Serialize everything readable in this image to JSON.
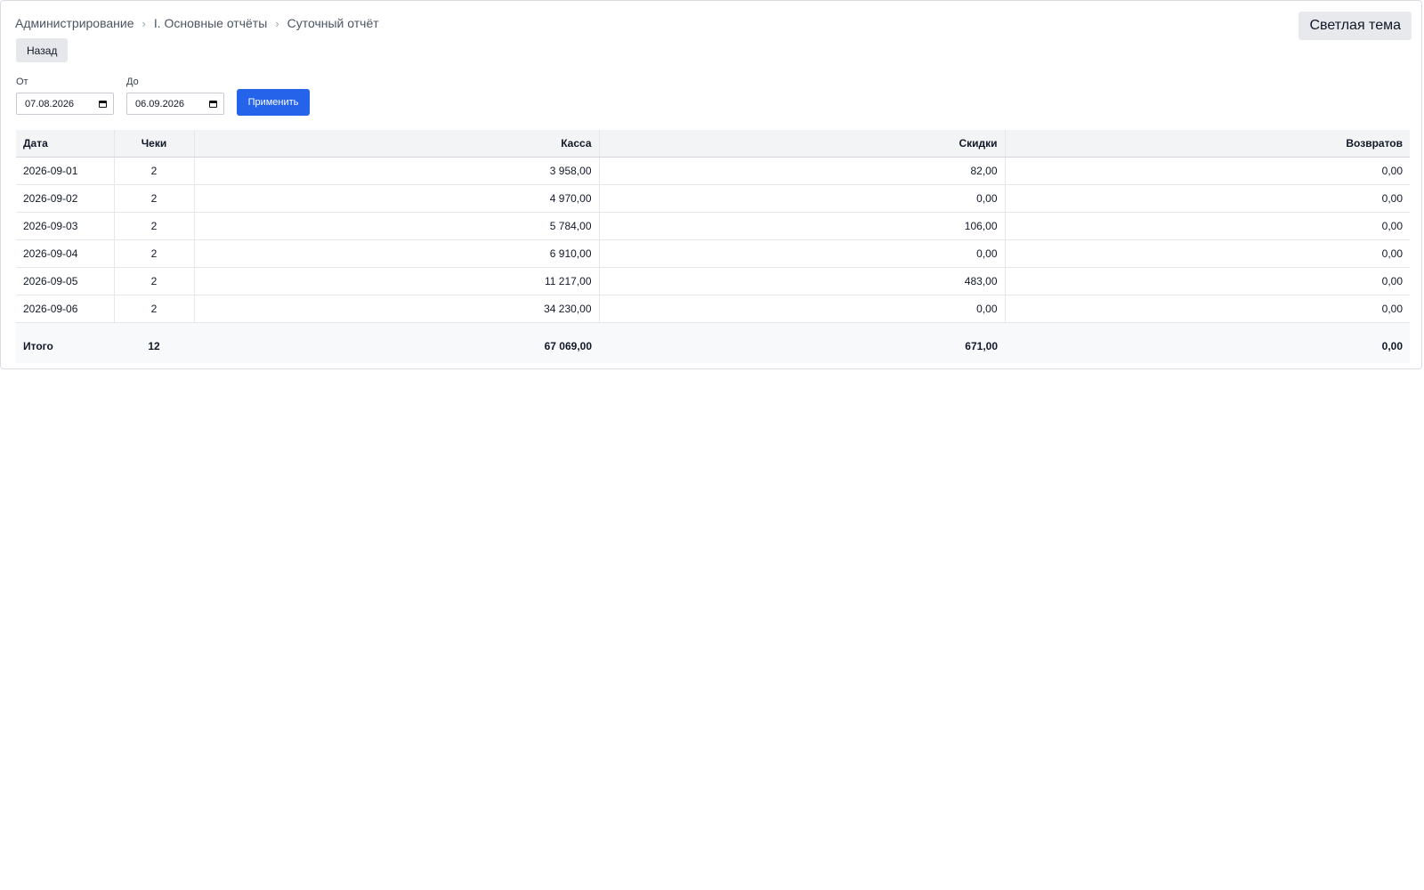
{
  "breadcrumb": {
    "items": [
      "Администрирование",
      "I. Основные отчёты",
      "Суточный отчёт"
    ],
    "separator": "›"
  },
  "theme_toggle_label": "Светлая тема",
  "back_button_label": "Назад",
  "filters": {
    "from_label": "От",
    "from_value": "07.08.2026",
    "to_label": "До",
    "to_value": "06.09.2026",
    "apply_label": "Применить"
  },
  "table": {
    "columns": [
      "Дата",
      "Чеки",
      "Касса",
      "Скидки",
      "Возвратов"
    ],
    "rows": [
      [
        "2026-09-01",
        "2",
        "3 958,00",
        "82,00",
        "0,00"
      ],
      [
        "2026-09-02",
        "2",
        "4 970,00",
        "0,00",
        "0,00"
      ],
      [
        "2026-09-03",
        "2",
        "5 784,00",
        "106,00",
        "0,00"
      ],
      [
        "2026-09-04",
        "2",
        "6 910,00",
        "0,00",
        "0,00"
      ],
      [
        "2026-09-05",
        "2",
        "11 217,00",
        "483,00",
        "0,00"
      ],
      [
        "2026-09-06",
        "2",
        "34 230,00",
        "0,00",
        "0,00"
      ]
    ],
    "totals": [
      "Итого",
      "12",
      "67 069,00",
      "671,00",
      "0,00"
    ]
  },
  "colors": {
    "accent": "#2563eb",
    "header_bg": "#f3f4f6",
    "button_bg": "#e5e7eb"
  },
  "icons": {
    "date_picker": "calendar-icon",
    "breadcrumb_separator": "chevron-right-icon"
  }
}
